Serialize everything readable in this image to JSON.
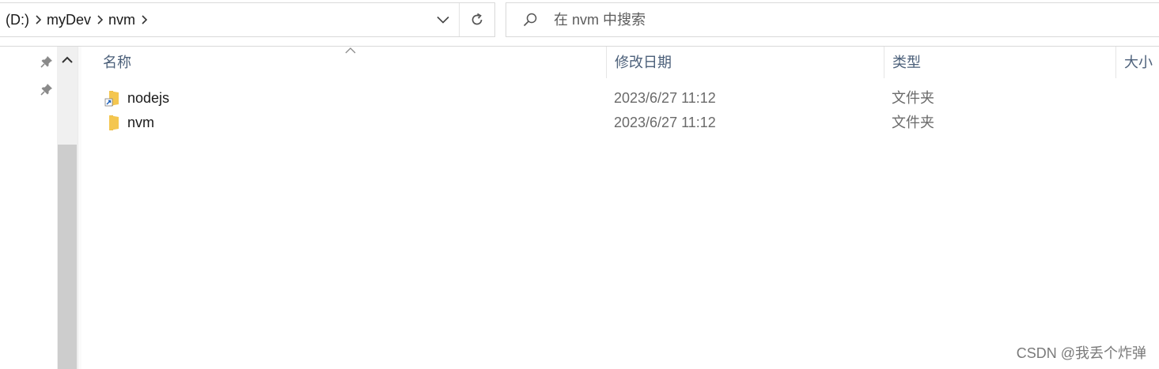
{
  "address_bar": {
    "breadcrumbs": [
      "(D:)",
      "myDev",
      "nvm"
    ],
    "dropdown_icon": "chevron-down-icon",
    "refresh_icon": "refresh-icon"
  },
  "search": {
    "placeholder": "在 nvm 中搜索",
    "icon": "search-icon"
  },
  "nav_pane": {
    "pin_icons": [
      "pin-icon",
      "pin-icon"
    ]
  },
  "columns": {
    "name": "名称",
    "date_modified": "修改日期",
    "type": "类型",
    "size": "大小",
    "sort_column": "name"
  },
  "files": [
    {
      "name": "nodejs",
      "date_modified": "2023/6/27 11:12",
      "type": "文件夹",
      "icon": "folder-shortcut-icon"
    },
    {
      "name": "nvm",
      "date_modified": "2023/6/27 11:12",
      "type": "文件夹",
      "icon": "folder-icon"
    }
  ],
  "watermark": "CSDN @我丢个炸弹",
  "colors": {
    "header_text": "#4c607a",
    "folder_yellow": "#f4c64f",
    "scroll_thumb": "#cdcdcd"
  }
}
